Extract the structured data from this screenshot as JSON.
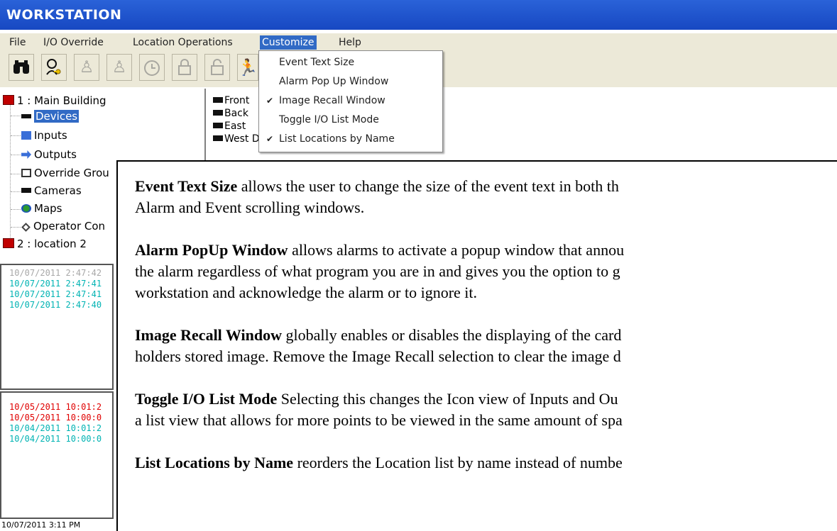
{
  "window": {
    "title": "WORKSTATION"
  },
  "menu": {
    "file": "File",
    "io_override": "I/O Override",
    "location_operations": "Location Operations",
    "customize": "Customize",
    "help": "Help"
  },
  "toolbar": {
    "buttons": [
      {
        "icon": "binoculars-icon",
        "enabled": true
      },
      {
        "icon": "key-logon-icon",
        "enabled": true
      },
      {
        "icon": "person-clock-icon",
        "enabled": false
      },
      {
        "icon": "person-clock-alt-icon",
        "enabled": false
      },
      {
        "icon": "timer-icon",
        "enabled": false
      },
      {
        "icon": "lock-icon",
        "enabled": false
      },
      {
        "icon": "unlock-icon",
        "enabled": false
      },
      {
        "icon": "running-person-icon",
        "enabled": false
      }
    ]
  },
  "tree": {
    "location1": "1 :  Main Building",
    "devices": "Devices",
    "inputs": "Inputs",
    "outputs": "Outputs",
    "override_groups": "Override Grou",
    "cameras": "Cameras",
    "maps": "Maps",
    "operator_commands": "Operator Con",
    "location2": "2 :  location 2"
  },
  "devices": [
    "Front",
    "Back",
    "East",
    "West Door"
  ],
  "event_log": {
    "entries": [
      {
        "text": "10/07/2011 2:47:42",
        "color": "#a8a8a8"
      },
      {
        "text": "10/07/2011 2:47:41",
        "color": "#00b3b3"
      },
      {
        "text": "10/07/2011 2:47:41",
        "color": "#00b3b3"
      },
      {
        "text": "10/07/2011 2:47:40",
        "color": "#00b3b3"
      }
    ]
  },
  "alarm_log": {
    "entries": [
      {
        "text": "10/05/2011 10:01:2",
        "color": "#e00000"
      },
      {
        "text": "10/05/2011 10:00:0",
        "color": "#e00000"
      },
      {
        "text": "10/04/2011 10:01:2",
        "color": "#00b3b3"
      },
      {
        "text": "10/04/2011 10:00:0",
        "color": "#00b3b3"
      }
    ]
  },
  "status_bar": {
    "datetime": "10/07/2011 3:11 PM"
  },
  "customize_menu": {
    "items": [
      {
        "label": "Event Text Size",
        "checked": false
      },
      {
        "label": "Alarm Pop Up Window",
        "checked": false
      },
      {
        "label": "Image Recall Window",
        "checked": true
      },
      {
        "label": "Toggle I/O List Mode",
        "checked": false
      },
      {
        "label": "List Locations by Name",
        "checked": true
      }
    ],
    "check_glyph": "✔"
  },
  "help_text": {
    "event_text_size": {
      "term": "Event Text Size",
      "line1": " allows the user to change the size of the event text in both th",
      "line2": "Alarm and Event scrolling windows."
    },
    "alarm_popup": {
      "term": "Alarm PopUp Window",
      "line1": " allows alarms to activate a popup window that annou",
      "line2": "the alarm regardless of what program you are in and gives you the option to g",
      "line3": "workstation and acknowledge the alarm or to ignore it."
    },
    "image_recall": {
      "term": "Image Recall Window",
      "line1": " globally enables or disables the displaying of the card",
      "line2": "holders stored image. Remove the Image Recall selection to clear the image d"
    },
    "toggle_io": {
      "term": "Toggle I/O List Mode",
      "line1": " Selecting this changes the Icon view of Inputs and Ou",
      "line2": "a list view that allows for more points to be viewed in the same amount of spa"
    },
    "list_locations": {
      "term": "List Locations by Name",
      "line1": " reorders the Location list by name instead of numbe"
    }
  }
}
